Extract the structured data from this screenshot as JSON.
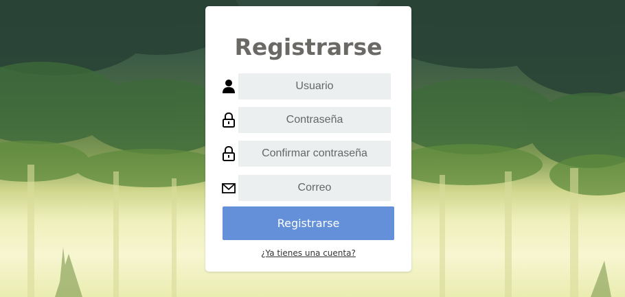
{
  "page": {
    "title": "Registrarse"
  },
  "form": {
    "fields": [
      {
        "icon": "user-icon",
        "placeholder": "Usuario",
        "value": ""
      },
      {
        "icon": "lock-icon",
        "placeholder": "Contraseña",
        "value": ""
      },
      {
        "icon": "lock-icon",
        "placeholder": "Confirmar contraseña",
        "value": ""
      },
      {
        "icon": "mail-icon",
        "placeholder": "Correo",
        "value": ""
      }
    ],
    "submit_label": "Registrarse",
    "login_link": "¿Ya tienes una cuenta?"
  },
  "colors": {
    "button": "#6390d9",
    "field_bg": "#ecefef",
    "title": "#6b6966"
  }
}
